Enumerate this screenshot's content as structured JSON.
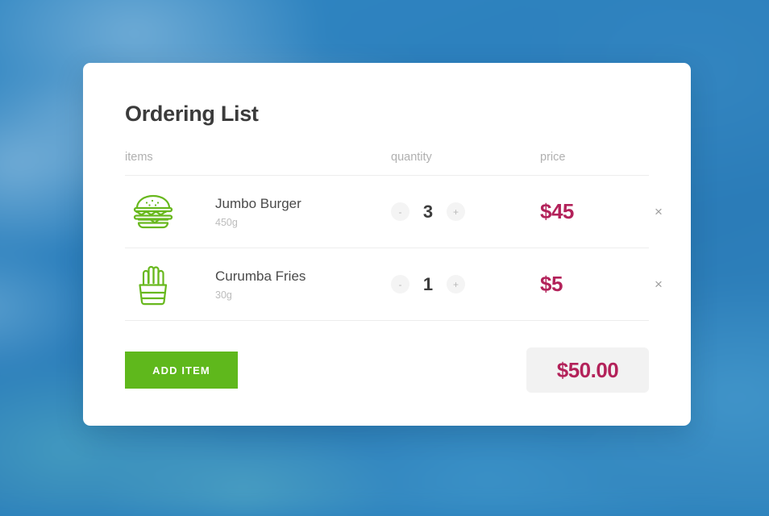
{
  "card": {
    "title": "Ordering List",
    "columns": {
      "items": "items",
      "quantity": "quantity",
      "price": "price"
    },
    "rows": [
      {
        "icon": "burger-icon",
        "name": "Jumbo Burger",
        "weight": "450g",
        "decrement_label": "-",
        "quantity": "3",
        "increment_label": "+",
        "price": "$45",
        "remove_label": "×"
      },
      {
        "icon": "fries-icon",
        "name": "Curumba Fries",
        "weight": "30g",
        "decrement_label": "-",
        "quantity": "1",
        "increment_label": "+",
        "price": "$5",
        "remove_label": "×"
      }
    ],
    "footer": {
      "add_item_label": "ADD ITEM",
      "total": "$50.00"
    }
  },
  "colors": {
    "accent_green": "#5fb81c",
    "price_crimson": "#b3225a",
    "background_blue": "#2d80bd",
    "card_white": "#ffffff",
    "total_pill": "#f2f2f2"
  }
}
